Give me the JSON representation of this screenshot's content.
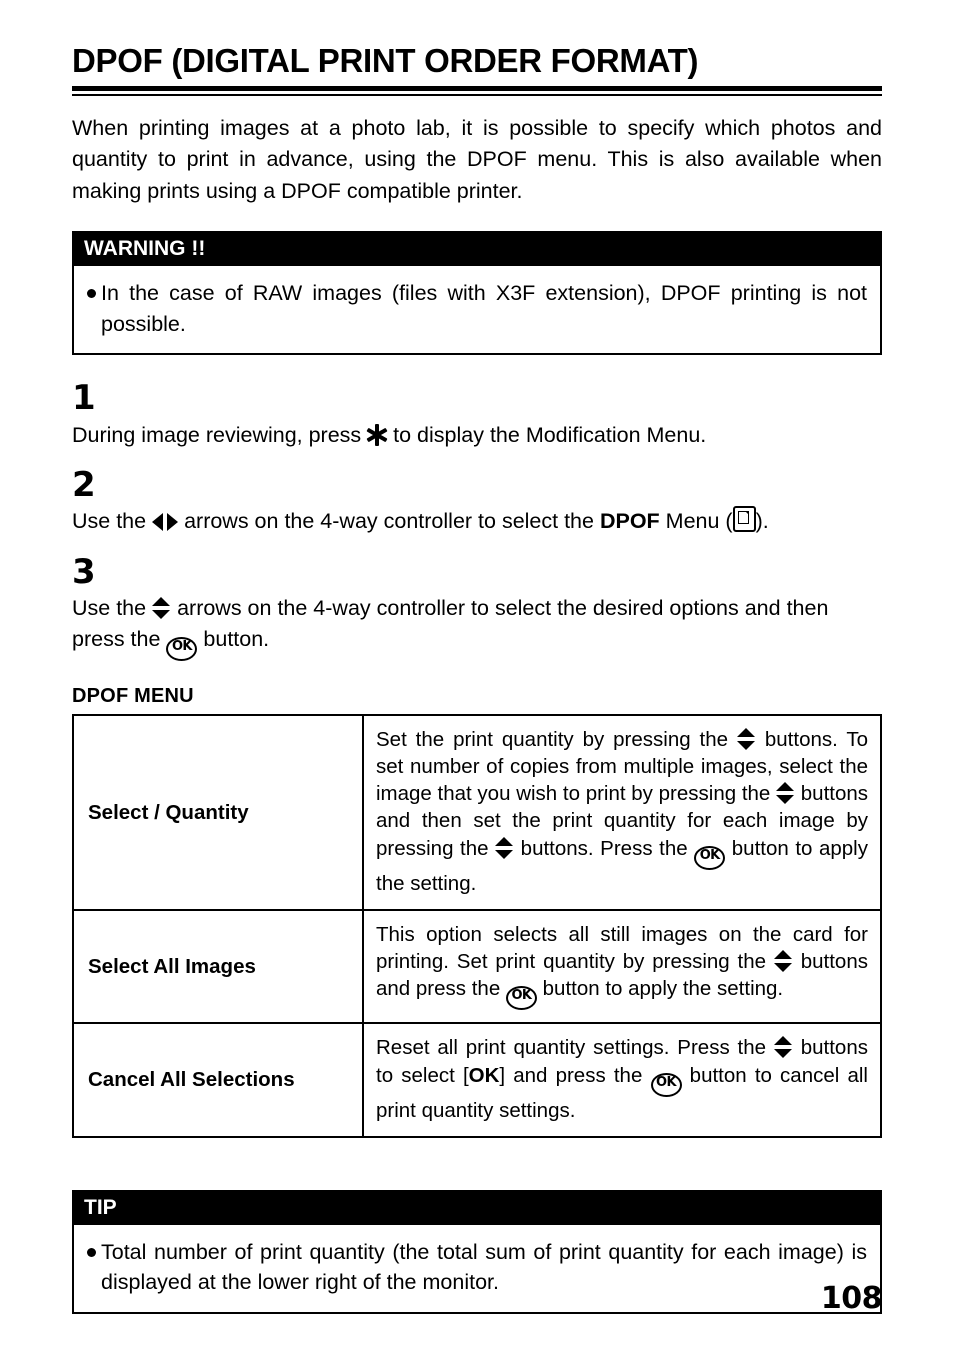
{
  "document": {
    "title": "DPOF (DIGITAL PRINT ORDER FORMAT)",
    "page_number": "108",
    "intro": "When printing images at a photo lab, it is possible to specify which photos and quantity to print in advance, using the DPOF menu. This is also available when making prints using a DPOF compatible printer."
  },
  "warning": {
    "heading": "WARNING !!",
    "bullet": "In the case of RAW images (files with X3F extension), DPOF printing is not possible."
  },
  "steps": {
    "one": {
      "number": "1",
      "text_before_icon": "During image reviewing, press",
      "icon": "asterisk-icon",
      "text_after_icon": "to display the Modification Menu."
    },
    "two": {
      "number": "2",
      "part1": "Use the",
      "icon1": "left-right-arrows-icon",
      "part2": "arrows on the 4-way controller to select the",
      "bold": "DPOF",
      "part3": "Menu (",
      "icon2": "dpof-page-icon",
      "part4": ")."
    },
    "three": {
      "number": "3",
      "part1": "Use the",
      "icon1": "up-down-arrows-icon",
      "part2": "arrows on the 4-way controller to select the desired options and then press the",
      "icon2": "ok-button-icon",
      "part3": "button."
    }
  },
  "menu_table": {
    "label": "DPOF MENU",
    "rows": [
      {
        "name": "Select / Quantity",
        "desc_part1": "Set the print quantity by pressing the",
        "icon1": "up-down-arrows-icon",
        "desc_part2": "buttons. To set number of copies from multiple images, select the image that you wish to print by pressing the",
        "icon2": "up-down-arrows-icon",
        "desc_part3": "buttons and then set the print quantity for each image by pressing the",
        "icon3": "up-down-arrows-icon",
        "desc_part4": "buttons. Press the",
        "icon4": "ok-button-icon",
        "desc_part5": "button to apply the setting."
      },
      {
        "name": "Select All Images",
        "desc_part1": "This option selects all still images on the card for printing. Set print quantity by pressing the",
        "icon1": "up-down-arrows-icon",
        "desc_part2": "buttons and press the",
        "icon2": "ok-button-icon",
        "desc_part3": "button to apply the setting."
      },
      {
        "name": "Cancel All Selections",
        "desc_part1": "Reset all print quantity settings. Press the",
        "icon1": "up-down-arrows-icon",
        "desc_part2": "buttons to select [",
        "bold_ok": "OK",
        "desc_part3": "] and press the",
        "icon2": "ok-button-icon",
        "desc_part4": "button to cancel all print quantity settings."
      }
    ]
  },
  "tip": {
    "heading": "TIP",
    "bullet": "Total number of print quantity (the total sum of print quantity for each image) is displayed at the lower right of the monitor."
  },
  "colors": {
    "text": "#000000",
    "background": "#ffffff",
    "callout_header_bg": "#000000",
    "callout_header_text": "#ffffff"
  }
}
